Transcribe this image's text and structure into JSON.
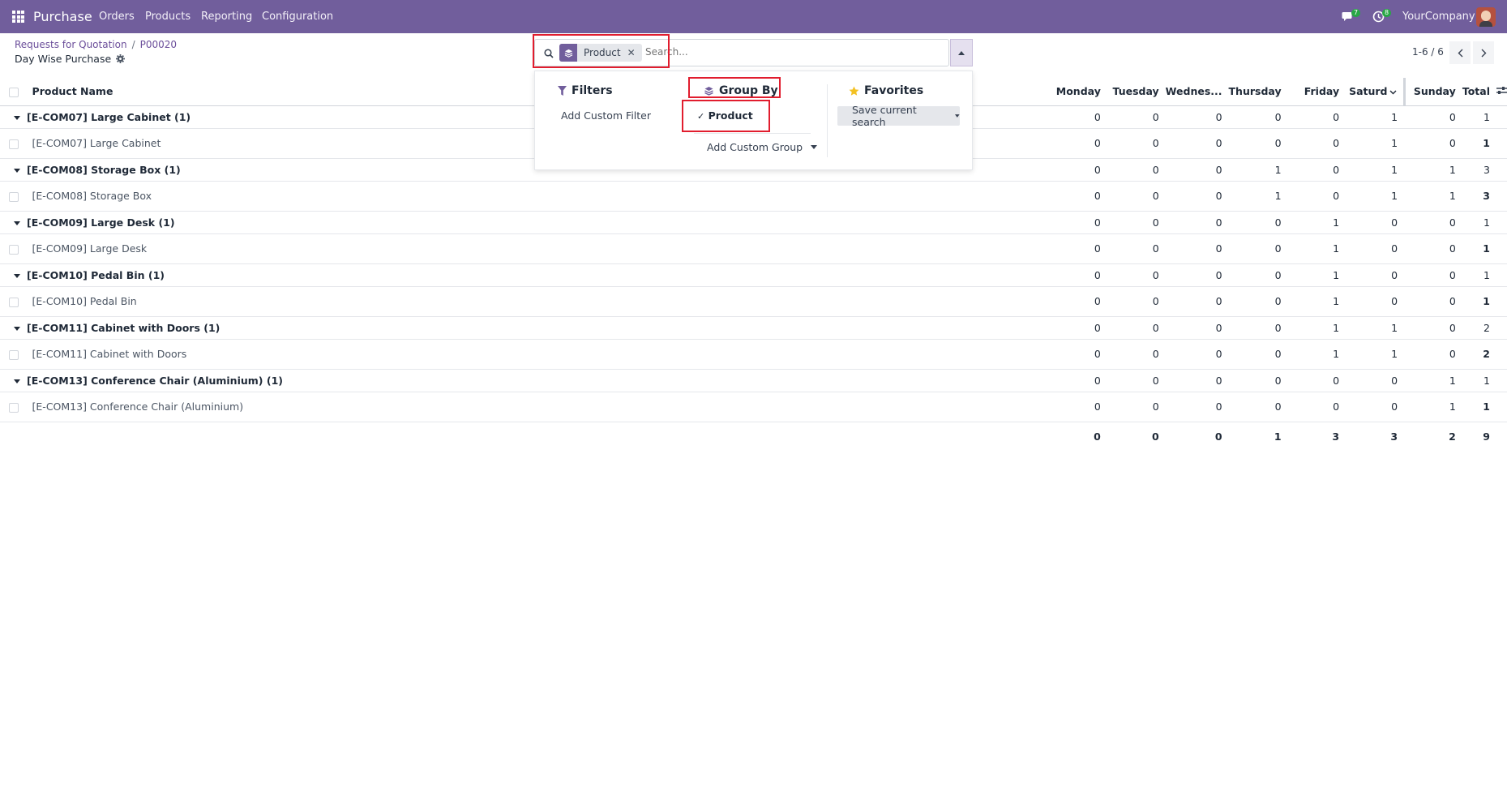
{
  "navbar": {
    "app_name": "Purchase",
    "menu": [
      "Orders",
      "Products",
      "Reporting",
      "Configuration"
    ],
    "messages_count": "7",
    "activities_count": "8",
    "company": "YourCompany"
  },
  "breadcrumb": {
    "parent": "Requests for Quotation",
    "current": "P00020",
    "separator": "/"
  },
  "view_title": "Day Wise Purchase",
  "search": {
    "facet_label": "Product",
    "placeholder": "Search..."
  },
  "pager": {
    "range": "1-6 / 6"
  },
  "dropdown": {
    "filters_title": "Filters",
    "add_custom_filter": "Add Custom Filter",
    "groupby_title": "Group By",
    "groupby_option": "Product",
    "add_custom_group": "Add Custom Group",
    "favorites_title": "Favorites",
    "save_current_search": "Save current search"
  },
  "table": {
    "columns": {
      "product": "Product Name",
      "monday": "Monday",
      "tuesday": "Tuesday",
      "wednesday": "Wednes...",
      "thursday": "Thursday",
      "friday": "Friday",
      "saturday": "Saturd",
      "sunday": "Sunday",
      "total": "Total"
    },
    "groups": [
      {
        "label": "[E-COM07] Large Cabinet (1)",
        "values": [
          "0",
          "0",
          "0",
          "0",
          "0",
          "1",
          "0",
          "1"
        ],
        "record": {
          "name": "[E-COM07] Large Cabinet",
          "values": [
            "0",
            "0",
            "0",
            "0",
            "0",
            "1",
            "0",
            "1"
          ]
        }
      },
      {
        "label": "[E-COM08] Storage Box (1)",
        "values": [
          "0",
          "0",
          "0",
          "1",
          "0",
          "1",
          "1",
          "3"
        ],
        "record": {
          "name": "[E-COM08] Storage Box",
          "values": [
            "0",
            "0",
            "0",
            "1",
            "0",
            "1",
            "1",
            "3"
          ]
        }
      },
      {
        "label": "[E-COM09] Large Desk (1)",
        "values": [
          "0",
          "0",
          "0",
          "0",
          "1",
          "0",
          "0",
          "1"
        ],
        "record": {
          "name": "[E-COM09] Large Desk",
          "values": [
            "0",
            "0",
            "0",
            "0",
            "1",
            "0",
            "0",
            "1"
          ]
        }
      },
      {
        "label": "[E-COM10] Pedal Bin (1)",
        "values": [
          "0",
          "0",
          "0",
          "0",
          "1",
          "0",
          "0",
          "1"
        ],
        "record": {
          "name": "[E-COM10] Pedal Bin",
          "values": [
            "0",
            "0",
            "0",
            "0",
            "1",
            "0",
            "0",
            "1"
          ]
        }
      },
      {
        "label": "[E-COM11] Cabinet with Doors (1)",
        "values": [
          "0",
          "0",
          "0",
          "0",
          "1",
          "1",
          "0",
          "2"
        ],
        "record": {
          "name": "[E-COM11] Cabinet with Doors",
          "values": [
            "0",
            "0",
            "0",
            "0",
            "1",
            "1",
            "0",
            "2"
          ]
        }
      },
      {
        "label": "[E-COM13] Conference Chair (Aluminium) (1)",
        "values": [
          "0",
          "0",
          "0",
          "0",
          "0",
          "0",
          "1",
          "1"
        ],
        "record": {
          "name": "[E-COM13] Conference Chair (Aluminium)",
          "values": [
            "0",
            "0",
            "0",
            "0",
            "0",
            "0",
            "1",
            "1"
          ]
        }
      }
    ],
    "totals": [
      "0",
      "0",
      "0",
      "1",
      "3",
      "3",
      "2",
      "9"
    ]
  },
  "colors": {
    "navbar": "#715e9c",
    "accent": "#6b4e9a",
    "highlight": "#e11d2e",
    "badge": "#28a745"
  }
}
